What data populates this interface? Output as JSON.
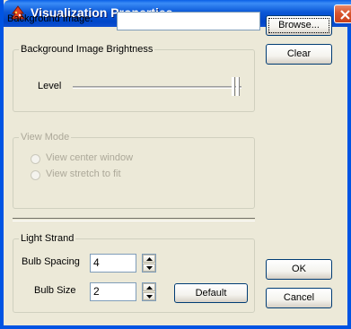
{
  "window": {
    "title": "Visualization Properties"
  },
  "background_image": {
    "label": "Background Image:",
    "value": "",
    "browse_label": "Browse...",
    "clear_label": "Clear"
  },
  "brightness": {
    "group_title": "Background Image Brightness",
    "level_label": "Level",
    "level_value": 1.0
  },
  "view_mode": {
    "group_title": "View Mode",
    "options": [
      "View center window",
      "View stretch to fit"
    ],
    "enabled": false
  },
  "light_strand": {
    "group_title": "Light Strand",
    "bulb_spacing_label": "Bulb Spacing",
    "bulb_spacing_value": "4",
    "bulb_size_label": "Bulb Size",
    "bulb_size_value": "2",
    "default_label": "Default"
  },
  "dialog_buttons": {
    "ok_label": "OK",
    "cancel_label": "Cancel"
  },
  "colors": {
    "titlebar": "#0054e3",
    "dialog_bg": "#ece9d8",
    "close_button": "#d9552e",
    "disabled_text": "#aca899"
  },
  "icons": {
    "title_icon": "app-tree-icon",
    "close_icon": "close-x-icon"
  }
}
